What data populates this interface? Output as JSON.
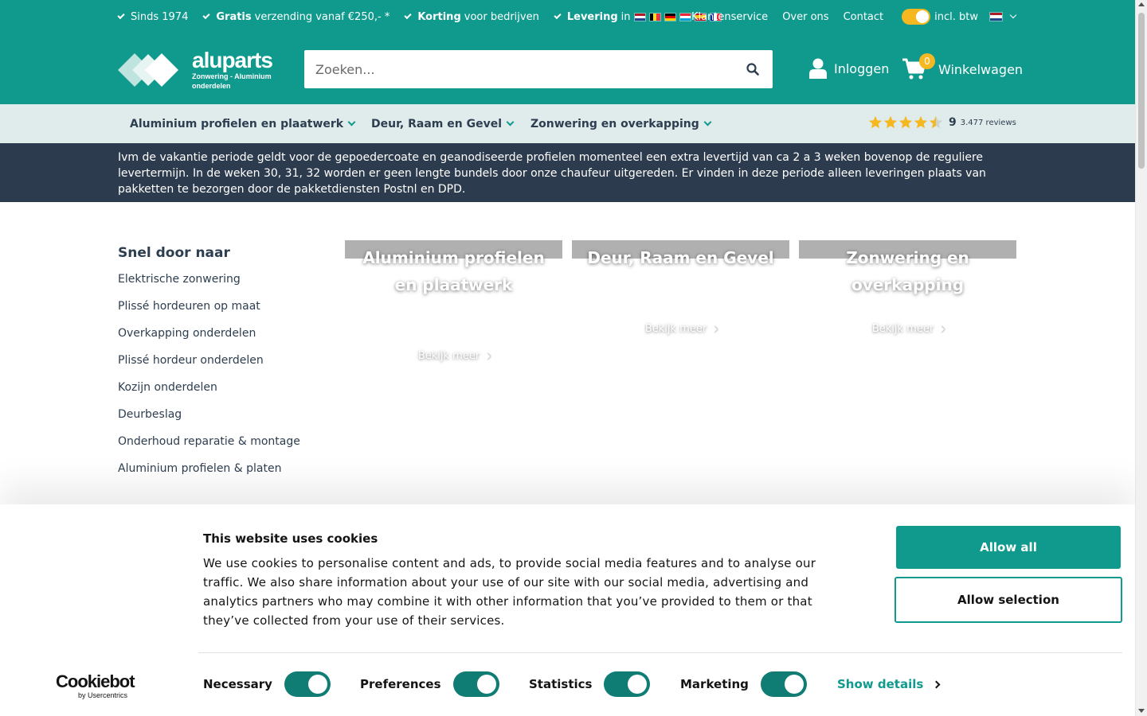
{
  "topbar": {
    "usps": [
      {
        "bold": "",
        "text": "Sinds 1974"
      },
      {
        "bold": "Gratis",
        "text": "verzending vanaf €250,- *"
      },
      {
        "bold": "Korting",
        "text": "voor bedrijven"
      },
      {
        "bold": "Levering",
        "text": "in"
      }
    ],
    "links": [
      "Klantenservice",
      "Over ons",
      "Contact"
    ],
    "vat_label": "incl. btw",
    "vat_toggle_on": true
  },
  "header": {
    "logo_name": "aluparts",
    "logo_tagline": "Zonwering - Aluminium onderdelen",
    "search_placeholder": "Zoeken...",
    "login_label": "Inloggen",
    "cart_label": "Winkelwagen",
    "cart_count": "0"
  },
  "nav": {
    "items": [
      "Aluminium profielen en plaatwerk",
      "Deur, Raam en Gevel",
      "Zonwering en overkapping"
    ],
    "rating_score": "9",
    "rating_reviews": "3.477 reviews",
    "rating_stars": 4.5
  },
  "notice": {
    "text": "Ivm de vakantie periode geldt voor de gepoedercoate en geanodiseerde profielen momenteel een extra levertijd van ca 2 a 3 weken bovenop de reguliere levertermijn. In de weken 30, 31, 32 worden er geen lengte bundels door onze chaufeur uitgereden. Er vinden in deze periode alleen leveringen plaats van pakketten te bezorgen door de pakketdiensten Postnl en DPD."
  },
  "quick_links": {
    "title": "Snel door naar",
    "items": [
      "Elektrische zonwering",
      "Plissé hordeuren op maat",
      "Overkapping onderdelen",
      "Plissé hordeur onderdelen",
      "Kozijn onderdelen",
      "Deurbeslag",
      "Onderhoud reparatie & montage",
      "Aluminium profielen & platen"
    ]
  },
  "categories": [
    {
      "title": "Aluminium profielen en plaatwerk",
      "more": "Bekijk meer"
    },
    {
      "title": "Deur, Raam en Gevel",
      "more": "Bekijk meer"
    },
    {
      "title": "Zonwering en overkapping",
      "more": "Bekijk meer"
    }
  ],
  "cookie": {
    "title": "This website uses cookies",
    "text": "We use cookies to personalise content and ads, to provide social media features and to analyse our traffic. We also share information about your use of our site with our social media, advertising and analytics partners who may combine it with other information that you’ve provided to them or that they’ve collected from your use of their services.",
    "allow_all": "Allow all",
    "allow_selection": "Allow selection",
    "consents": [
      "Necessary",
      "Preferences",
      "Statistics",
      "Marketing"
    ],
    "show_details": "Show details",
    "brand": "Cookiebot",
    "brand_sub": "by Usercentrics"
  },
  "colors": {
    "brand_teal": "#0f9a8d",
    "accent_yellow": "#f5b820",
    "navy": "#2d3b4e",
    "nav_bg": "#e0ecec"
  }
}
